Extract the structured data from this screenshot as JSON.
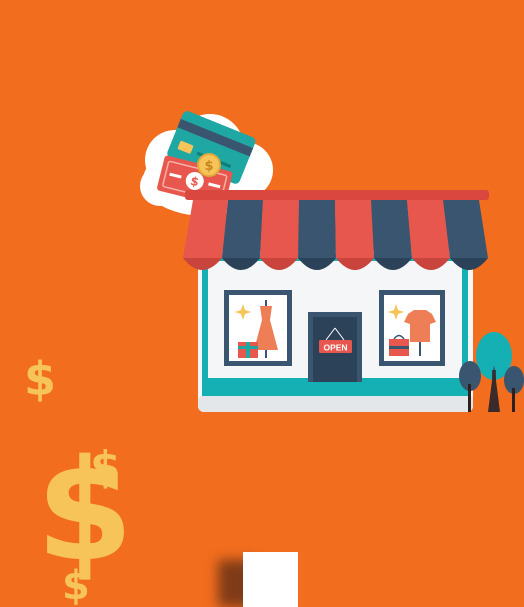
{
  "scene": {
    "background_color": "#f26d1e",
    "accent_gold": "#f7c45a",
    "awning_red": "#e8574e",
    "awning_navy": "#3a5570",
    "teal": "#15b0b3"
  },
  "store": {
    "door_sign": "OPEN"
  },
  "payment": {
    "cash_symbol": "$",
    "coin_symbol": "$"
  },
  "decor": {
    "dollar_signs": [
      "$",
      "$",
      "$",
      "$"
    ]
  }
}
